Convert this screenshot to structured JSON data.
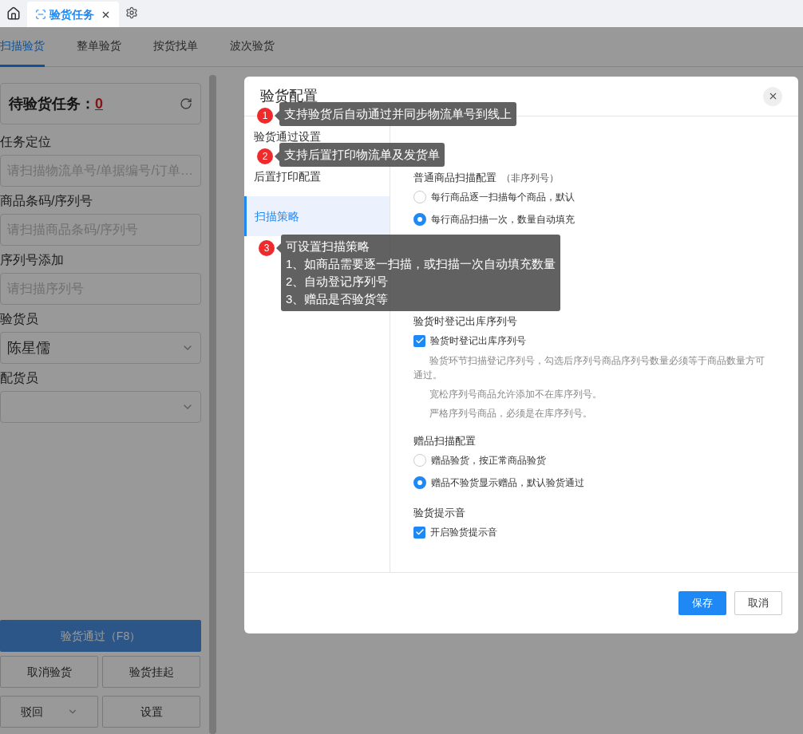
{
  "top_tabs": [
    {
      "label": "验货任务",
      "selected": true
    }
  ],
  "page_tabs": [
    {
      "label": "扫描验货",
      "selected": true
    },
    {
      "label": "整单验货",
      "selected": false
    },
    {
      "label": "按货找单",
      "selected": false
    },
    {
      "label": "波次验货",
      "selected": false
    }
  ],
  "pending": {
    "label": "待验货任务：",
    "count": "0"
  },
  "fields": [
    {
      "kind": "input",
      "label": "任务定位",
      "placeholder": "请扫描物流单号/单据编号/订单…"
    },
    {
      "kind": "input",
      "label": "商品条码/序列号",
      "placeholder": "请扫描商品条码/序列号"
    },
    {
      "kind": "input",
      "label": "序列号添加",
      "placeholder": "请扫描序列号"
    },
    {
      "kind": "select",
      "label": "验货员",
      "value": "陈星儒"
    },
    {
      "kind": "select",
      "label": "配货员"
    }
  ],
  "actions": {
    "primary": "验货通过（F8）",
    "cancel": "取消验货",
    "suspend": "验货挂起",
    "reject": "驳回",
    "settings": "设置"
  },
  "dialog": {
    "title": "验货配置",
    "nav": [
      {
        "label": "验货通过设置",
        "selected": false
      },
      {
        "label": "后置打印配置",
        "selected": false
      },
      {
        "label": "扫描策略",
        "selected": true
      }
    ],
    "sections": [
      {
        "title": "普通商品扫描配置",
        "note": "（非序列号）",
        "items": [
          {
            "kind": "radio",
            "label": "每行商品逐一扫描每个商品，默认",
            "selected": false
          },
          {
            "kind": "radio",
            "label": "每行商品扫描一次，数量自动填充",
            "selected": true
          }
        ]
      },
      {
        "title": "验货时登记出库序列号",
        "items": [
          {
            "kind": "checkbox",
            "label": "验货时登记出库序列号",
            "checked": true
          },
          {
            "kind": "hint",
            "label": "验货环节扫描登记序列号，勾选后序列号商品序列号数量必须等于商品数量方可通过。"
          },
          {
            "kind": "note",
            "label": "宽松序列号商品允许添加不在库序列号。"
          },
          {
            "kind": "note",
            "label": "严格序列号商品，必须是在库序列号。"
          }
        ]
      },
      {
        "title": "赠品扫描配置",
        "items": [
          {
            "kind": "radio",
            "label": "赠品验货，按正常商品验货",
            "selected": false
          },
          {
            "kind": "radio",
            "label": "赠品不验货显示赠品，默认验货通过",
            "selected": true
          }
        ]
      },
      {
        "title": "验货提示音",
        "items": [
          {
            "kind": "checkbox",
            "label": "开启验货提示音",
            "checked": true
          }
        ]
      }
    ],
    "buttons": {
      "save": "保存",
      "cancel": "取消"
    }
  },
  "tooltips": [
    {
      "number": "1",
      "lines": [
        "支持验货后自动通过并同步物流单号到线上"
      ]
    },
    {
      "number": "2",
      "lines": [
        "支持后置打印物流单及发货单"
      ]
    },
    {
      "number": "3",
      "lines": [
        "可设置扫描策略",
        "1、如商品需要逐一扫描，或扫描一次自动填充数量",
        "2、自动登记序列号",
        "3、赠品是否验货等"
      ]
    }
  ]
}
